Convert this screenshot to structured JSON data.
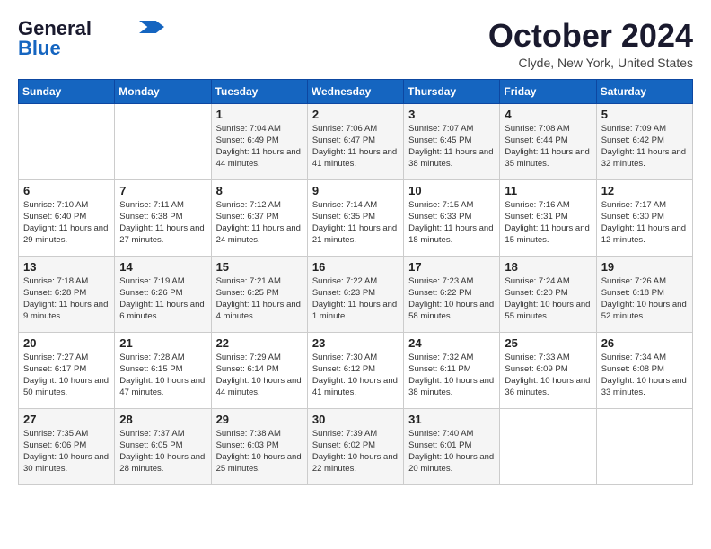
{
  "logo": {
    "line1": "General",
    "line2": "Blue",
    "arrow_unicode": "▶"
  },
  "title": "October 2024",
  "location": "Clyde, New York, United States",
  "weekdays": [
    "Sunday",
    "Monday",
    "Tuesday",
    "Wednesday",
    "Thursday",
    "Friday",
    "Saturday"
  ],
  "weeks": [
    [
      {
        "day": "",
        "sunrise": "",
        "sunset": "",
        "daylight": ""
      },
      {
        "day": "",
        "sunrise": "",
        "sunset": "",
        "daylight": ""
      },
      {
        "day": "1",
        "sunrise": "Sunrise: 7:04 AM",
        "sunset": "Sunset: 6:49 PM",
        "daylight": "Daylight: 11 hours and 44 minutes."
      },
      {
        "day": "2",
        "sunrise": "Sunrise: 7:06 AM",
        "sunset": "Sunset: 6:47 PM",
        "daylight": "Daylight: 11 hours and 41 minutes."
      },
      {
        "day": "3",
        "sunrise": "Sunrise: 7:07 AM",
        "sunset": "Sunset: 6:45 PM",
        "daylight": "Daylight: 11 hours and 38 minutes."
      },
      {
        "day": "4",
        "sunrise": "Sunrise: 7:08 AM",
        "sunset": "Sunset: 6:44 PM",
        "daylight": "Daylight: 11 hours and 35 minutes."
      },
      {
        "day": "5",
        "sunrise": "Sunrise: 7:09 AM",
        "sunset": "Sunset: 6:42 PM",
        "daylight": "Daylight: 11 hours and 32 minutes."
      }
    ],
    [
      {
        "day": "6",
        "sunrise": "Sunrise: 7:10 AM",
        "sunset": "Sunset: 6:40 PM",
        "daylight": "Daylight: 11 hours and 29 minutes."
      },
      {
        "day": "7",
        "sunrise": "Sunrise: 7:11 AM",
        "sunset": "Sunset: 6:38 PM",
        "daylight": "Daylight: 11 hours and 27 minutes."
      },
      {
        "day": "8",
        "sunrise": "Sunrise: 7:12 AM",
        "sunset": "Sunset: 6:37 PM",
        "daylight": "Daylight: 11 hours and 24 minutes."
      },
      {
        "day": "9",
        "sunrise": "Sunrise: 7:14 AM",
        "sunset": "Sunset: 6:35 PM",
        "daylight": "Daylight: 11 hours and 21 minutes."
      },
      {
        "day": "10",
        "sunrise": "Sunrise: 7:15 AM",
        "sunset": "Sunset: 6:33 PM",
        "daylight": "Daylight: 11 hours and 18 minutes."
      },
      {
        "day": "11",
        "sunrise": "Sunrise: 7:16 AM",
        "sunset": "Sunset: 6:31 PM",
        "daylight": "Daylight: 11 hours and 15 minutes."
      },
      {
        "day": "12",
        "sunrise": "Sunrise: 7:17 AM",
        "sunset": "Sunset: 6:30 PM",
        "daylight": "Daylight: 11 hours and 12 minutes."
      }
    ],
    [
      {
        "day": "13",
        "sunrise": "Sunrise: 7:18 AM",
        "sunset": "Sunset: 6:28 PM",
        "daylight": "Daylight: 11 hours and 9 minutes."
      },
      {
        "day": "14",
        "sunrise": "Sunrise: 7:19 AM",
        "sunset": "Sunset: 6:26 PM",
        "daylight": "Daylight: 11 hours and 6 minutes."
      },
      {
        "day": "15",
        "sunrise": "Sunrise: 7:21 AM",
        "sunset": "Sunset: 6:25 PM",
        "daylight": "Daylight: 11 hours and 4 minutes."
      },
      {
        "day": "16",
        "sunrise": "Sunrise: 7:22 AM",
        "sunset": "Sunset: 6:23 PM",
        "daylight": "Daylight: 11 hours and 1 minute."
      },
      {
        "day": "17",
        "sunrise": "Sunrise: 7:23 AM",
        "sunset": "Sunset: 6:22 PM",
        "daylight": "Daylight: 10 hours and 58 minutes."
      },
      {
        "day": "18",
        "sunrise": "Sunrise: 7:24 AM",
        "sunset": "Sunset: 6:20 PM",
        "daylight": "Daylight: 10 hours and 55 minutes."
      },
      {
        "day": "19",
        "sunrise": "Sunrise: 7:26 AM",
        "sunset": "Sunset: 6:18 PM",
        "daylight": "Daylight: 10 hours and 52 minutes."
      }
    ],
    [
      {
        "day": "20",
        "sunrise": "Sunrise: 7:27 AM",
        "sunset": "Sunset: 6:17 PM",
        "daylight": "Daylight: 10 hours and 50 minutes."
      },
      {
        "day": "21",
        "sunrise": "Sunrise: 7:28 AM",
        "sunset": "Sunset: 6:15 PM",
        "daylight": "Daylight: 10 hours and 47 minutes."
      },
      {
        "day": "22",
        "sunrise": "Sunrise: 7:29 AM",
        "sunset": "Sunset: 6:14 PM",
        "daylight": "Daylight: 10 hours and 44 minutes."
      },
      {
        "day": "23",
        "sunrise": "Sunrise: 7:30 AM",
        "sunset": "Sunset: 6:12 PM",
        "daylight": "Daylight: 10 hours and 41 minutes."
      },
      {
        "day": "24",
        "sunrise": "Sunrise: 7:32 AM",
        "sunset": "Sunset: 6:11 PM",
        "daylight": "Daylight: 10 hours and 38 minutes."
      },
      {
        "day": "25",
        "sunrise": "Sunrise: 7:33 AM",
        "sunset": "Sunset: 6:09 PM",
        "daylight": "Daylight: 10 hours and 36 minutes."
      },
      {
        "day": "26",
        "sunrise": "Sunrise: 7:34 AM",
        "sunset": "Sunset: 6:08 PM",
        "daylight": "Daylight: 10 hours and 33 minutes."
      }
    ],
    [
      {
        "day": "27",
        "sunrise": "Sunrise: 7:35 AM",
        "sunset": "Sunset: 6:06 PM",
        "daylight": "Daylight: 10 hours and 30 minutes."
      },
      {
        "day": "28",
        "sunrise": "Sunrise: 7:37 AM",
        "sunset": "Sunset: 6:05 PM",
        "daylight": "Daylight: 10 hours and 28 minutes."
      },
      {
        "day": "29",
        "sunrise": "Sunrise: 7:38 AM",
        "sunset": "Sunset: 6:03 PM",
        "daylight": "Daylight: 10 hours and 25 minutes."
      },
      {
        "day": "30",
        "sunrise": "Sunrise: 7:39 AM",
        "sunset": "Sunset: 6:02 PM",
        "daylight": "Daylight: 10 hours and 22 minutes."
      },
      {
        "day": "31",
        "sunrise": "Sunrise: 7:40 AM",
        "sunset": "Sunset: 6:01 PM",
        "daylight": "Daylight: 10 hours and 20 minutes."
      },
      {
        "day": "",
        "sunrise": "",
        "sunset": "",
        "daylight": ""
      },
      {
        "day": "",
        "sunrise": "",
        "sunset": "",
        "daylight": ""
      }
    ]
  ]
}
